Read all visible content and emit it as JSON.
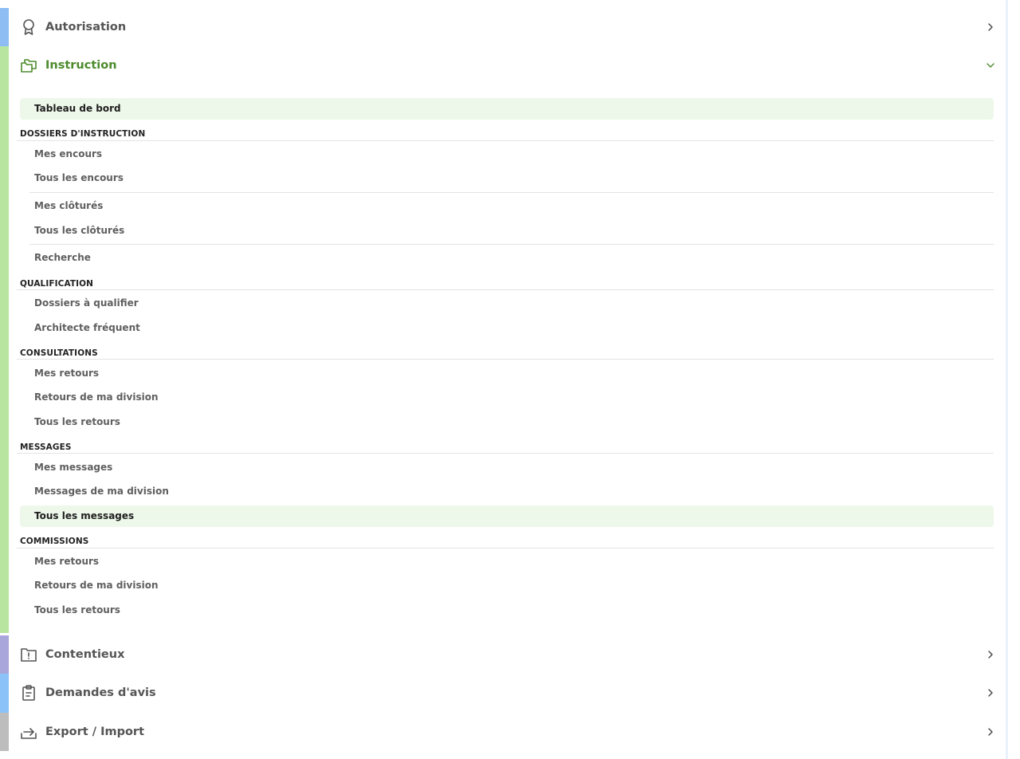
{
  "sidebar": {
    "colors": {
      "autorisation_strip": "#8dbdf2",
      "instruction_strip": "#b8e6a1",
      "contentieux_strip": "#a9a6dc",
      "demandes_strip": "#8bc2f7",
      "export_strip": "#bdbdbd",
      "active_section": "#4d8b2c",
      "highlight_bg": "#eef8ea"
    },
    "sections": {
      "autorisation": {
        "title": "Autorisation",
        "icon": "award-icon",
        "chevron": "chevron-right-icon"
      },
      "instruction": {
        "title": "Instruction",
        "icon": "folders-icon",
        "chevron": "chevron-down-icon",
        "expanded": true
      },
      "contentieux": {
        "title": "Contentieux",
        "icon": "folder-alert-icon",
        "chevron": "chevron-right-icon"
      },
      "demandes_avis": {
        "title": "Demandes d'avis",
        "icon": "clipboard-icon",
        "chevron": "chevron-right-icon"
      },
      "export_import": {
        "title": "Export / Import",
        "icon": "export-icon",
        "chevron": "chevron-right-icon"
      }
    },
    "instruction_menu": {
      "tableau_de_bord": "Tableau de bord",
      "cat_dossiers": "DOSSIERS D'INSTRUCTION",
      "mes_encours": "Mes encours",
      "tous_encours": "Tous les encours",
      "mes_clotures": "Mes clôturés",
      "tous_clotures": "Tous les clôturés",
      "recherche": "Recherche",
      "cat_qualification": "QUALIFICATION",
      "dossiers_qualifier": "Dossiers à qualifier",
      "architecte_frequent": "Architecte fréquent",
      "cat_consultations": "CONSULTATIONS",
      "consult_mes_retours": "Mes retours",
      "consult_retours_division": "Retours de ma division",
      "consult_tous_retours": "Tous les retours",
      "cat_messages": "MESSAGES",
      "mes_messages": "Mes messages",
      "messages_division": "Messages de ma division",
      "tous_messages": "Tous les messages",
      "cat_commissions": "COMMISSIONS",
      "comm_mes_retours": "Mes retours",
      "comm_retours_division": "Retours de ma division",
      "comm_tous_retours": "Tous les retours"
    }
  }
}
